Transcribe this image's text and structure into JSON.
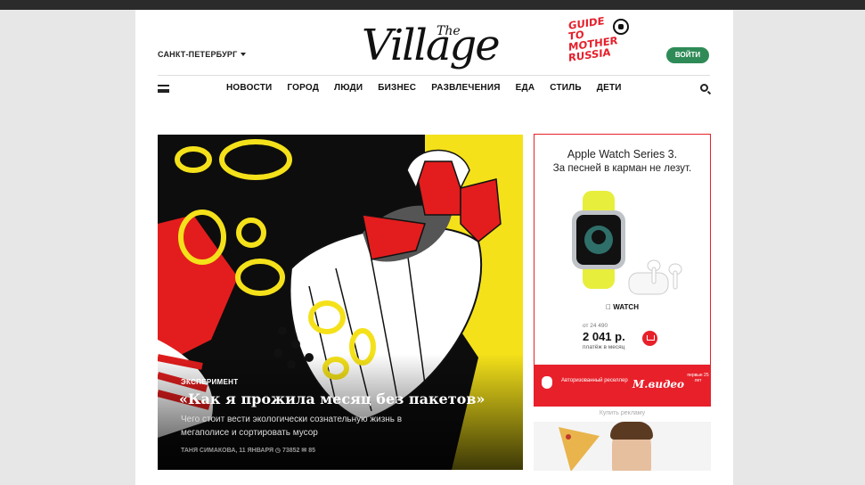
{
  "header": {
    "city": "САНКТ-ПЕТЕРБУРГ",
    "logo_the": "The",
    "logo_main": "Village",
    "promo_lines": [
      "GUIDE",
      "TO",
      "MOTHER",
      "RUSSIA"
    ],
    "login_label": "ВОЙТИ"
  },
  "nav": {
    "items": [
      "НОВОСТИ",
      "ГОРОД",
      "ЛЮДИ",
      "БИЗНЕС",
      "РАЗВЛЕЧЕНИЯ",
      "ЕДА",
      "СТИЛЬ",
      "ДЕТИ"
    ]
  },
  "hero": {
    "tag": "ЭКСПЕРИМЕНТ",
    "title": "«Как я прожила месяц без пакетов»",
    "subtitle": "Чего стоит вести экологически сознательную жизнь в мегаполисе и сортировать мусор",
    "meta": "ТАНЯ СИМАКОВА, 11 ЯНВАРЯ   ◷ 73852   ✉ 85"
  },
  "ad": {
    "title": "Apple Watch Series 3.",
    "subtitle": "За песней в карман не лезут.",
    "watch_logo": "WATCH",
    "price_from": "от 24 490",
    "price": "2 041 р.",
    "price_note": "платёж в месяц",
    "reseller": "Авторизованный реселлер",
    "store": "М.видео",
    "years": "первые 25 лет",
    "accent_color": "#e8202a"
  },
  "ad_link": "Купить рекламу",
  "colors": {
    "login": "#2e8b57",
    "topbar": "#2b2b2b"
  }
}
